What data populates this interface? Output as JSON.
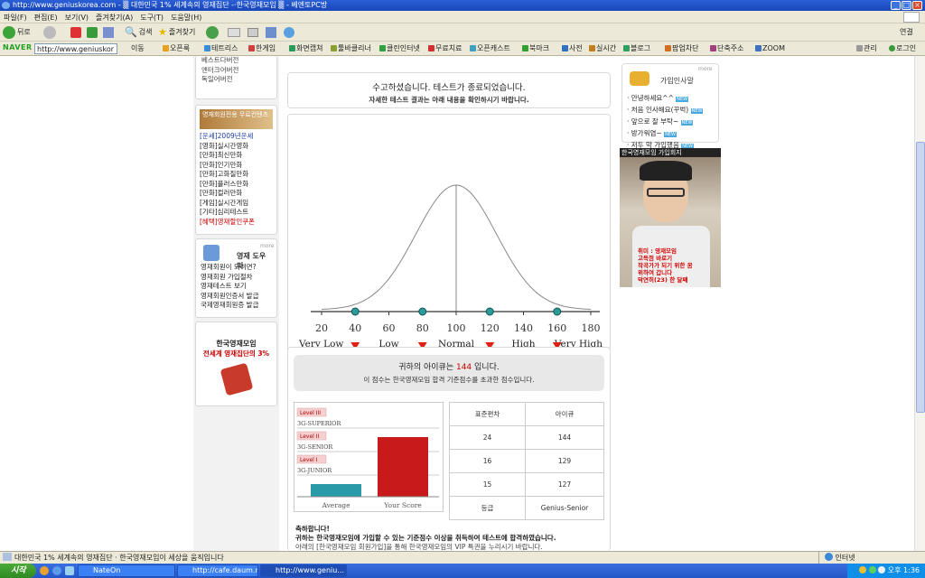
{
  "window": {
    "title": "http://www.geniuskorea.com - ▒ 대한민국 1% 세계속의 영재집단 -·한국영재모임 ▒ - 베엔토PC방"
  },
  "menu": [
    "파일(F)",
    "편집(E)",
    "보기(V)",
    "즐겨찾기(A)",
    "도구(T)",
    "도움말(H)"
  ],
  "toolbar": {
    "back": "뒤로",
    "search": "검색",
    "favorites": "즐겨찾기",
    "links": "연결"
  },
  "navbar": {
    "logo": "NAVER",
    "url": "http://www.geniuskor",
    "items": [
      "이동",
      "오픈룩",
      "테트리스",
      "한게임",
      "화면캡쳐",
      "툴바클리너",
      "클린인터넷",
      "무료치료",
      "오픈캐스트",
      "북마크",
      "사전",
      "실시간",
      "블로그",
      "팝업차단",
      "단축주소",
      "ZOOM"
    ],
    "right": [
      "관리",
      "로그인"
    ]
  },
  "leftcol": {
    "top_links": [
      "베스트다버전",
      "엔터크어버전",
      "독일어버전"
    ],
    "promo_banner": "영재회원전용 무료컨텐츠",
    "promo_items": [
      "[운세]2009년운세",
      "[영화]실시간영화",
      "[만화]최신만화",
      "[만화]인기만화",
      "[만화]고화질만화",
      "[만화]플러스만화",
      "[만화]컬러만화",
      "[게임]실시간게임",
      "[기타]심리테스트",
      "[혜택]영재할인쿠폰"
    ],
    "help_title": "영재 도우미",
    "more": "more",
    "help_items": [
      "영재회원이 되려면?",
      "영재회원 가입절차",
      "영재테스트 보기",
      "영재회원인증서 발급",
      "국제영재회원증 발급"
    ],
    "ad_title": "한국영재모임",
    "ad_sub": "전세계 영재집단의 3%"
  },
  "header": {
    "line1": "수고하셨습니다. 테스트가 종료되었습니다.",
    "line2": "자세한 테스트 결과는 아래 내용을 확인하시기 바랍니다."
  },
  "curve": {
    "ticks": [
      "20",
      "40",
      "60",
      "80",
      "100",
      "120",
      "140",
      "160",
      "180"
    ],
    "markers": [
      40,
      80,
      120,
      160
    ],
    "bands": [
      "Very Low",
      "Low",
      "Normal",
      "High",
      "Very High"
    ],
    "score": 144,
    "score_label": "144"
  },
  "result": {
    "line1_pre": "귀하의 아이큐는 ",
    "iq": "144",
    "line1_post": " 입니다.",
    "line2": "이 점수는 한국영재모임 합격 기준점수를 초과한 점수입니다.",
    "levels": [
      {
        "badge": "Level III",
        "name": "3G-SUPERIOR"
      },
      {
        "badge": "Level II",
        "name": "3G-SENIOR"
      },
      {
        "badge": "Level I",
        "name": "3G-JUNIOR"
      }
    ],
    "bar_labels": [
      "Average",
      "Your Score"
    ],
    "table_headers": [
      "표준편차",
      "아이큐"
    ],
    "table_rows": [
      [
        "24",
        "144"
      ],
      [
        "16",
        "129"
      ],
      [
        "15",
        "127"
      ],
      [
        "등급",
        "Genius-Senior"
      ]
    ],
    "congrats_title": "축하합니다!",
    "congrats_line1": "귀하는 한국영재모임에 가입할 수 있는 기준점수 이상을 취득하여 테스트에 합격하였습니다.",
    "congrats_line2": "아래의 [한국영재모임 회원가입]을 통해 한국영재모임의 VIP 특권을 누리시기 바랍니다."
  },
  "rightcol": {
    "more": "more",
    "greet_title": "가입인사말",
    "greet_items": [
      "안녕하세요^^",
      "처음 인사해요(꾸벅)",
      "앞으로 잘 부탁~",
      "방가워염~",
      "저두 막 가입했음"
    ],
    "new_badge": "NEW",
    "photo_caption": "한국영재모임 가입회지",
    "photo_text": [
      "취미 : 영재모임",
      "고득점 바로기",
      "작곡가가 되기 위한 꿈",
      "위하여 갑니다",
      "막연히(23) 한 달째"
    ]
  },
  "status": {
    "text": "대한민국 1% 세계속의 영재집단 · 한국영재모임이 세상을 움직입니다",
    "zone": "인터넷"
  },
  "taskbar": {
    "start": "시작",
    "tasks": [
      "NateOn",
      "http://cafe.daum.net...",
      "http://www.geniu..."
    ],
    "clock": "오후 1:36"
  },
  "colors": {
    "accent_red": "#cc0000",
    "bar_red": "#e8200e",
    "teal": "#2a8a8a"
  }
}
